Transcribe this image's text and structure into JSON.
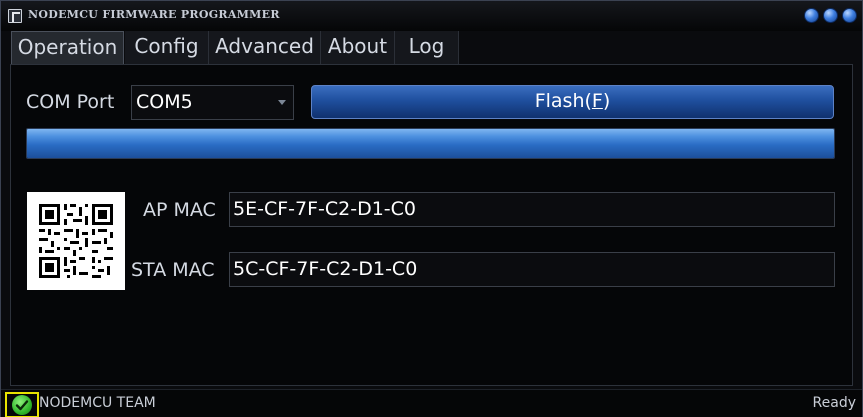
{
  "window": {
    "title": "NODEMCU FIRMWARE PROGRAMMER"
  },
  "tabs": [
    {
      "label": "Operation",
      "active": true
    },
    {
      "label": "Config"
    },
    {
      "label": "Advanced"
    },
    {
      "label": "About"
    },
    {
      "label": "Log"
    }
  ],
  "operation": {
    "com_port_label": "COM Port",
    "com_port_value": "COM5",
    "flash_button_label": "Flash(",
    "flash_button_mnemonic": "F",
    "flash_button_suffix": ")",
    "progress": 1.0,
    "ap_mac_label": "AP MAC",
    "ap_mac_value": "5E-CF-7F-C2-D1-C0",
    "sta_mac_label": "STA MAC",
    "sta_mac_value": "5C-CF-7F-C2-D1-C0"
  },
  "status_bar": {
    "team_text": "NODEMCU TEAM",
    "status_text": "Ready",
    "status_icon": "check-circle-icon",
    "accent": "#e8e400"
  },
  "colors": {
    "accent_blue": "#2a6cc4",
    "ok_green": "#2fb62a"
  }
}
